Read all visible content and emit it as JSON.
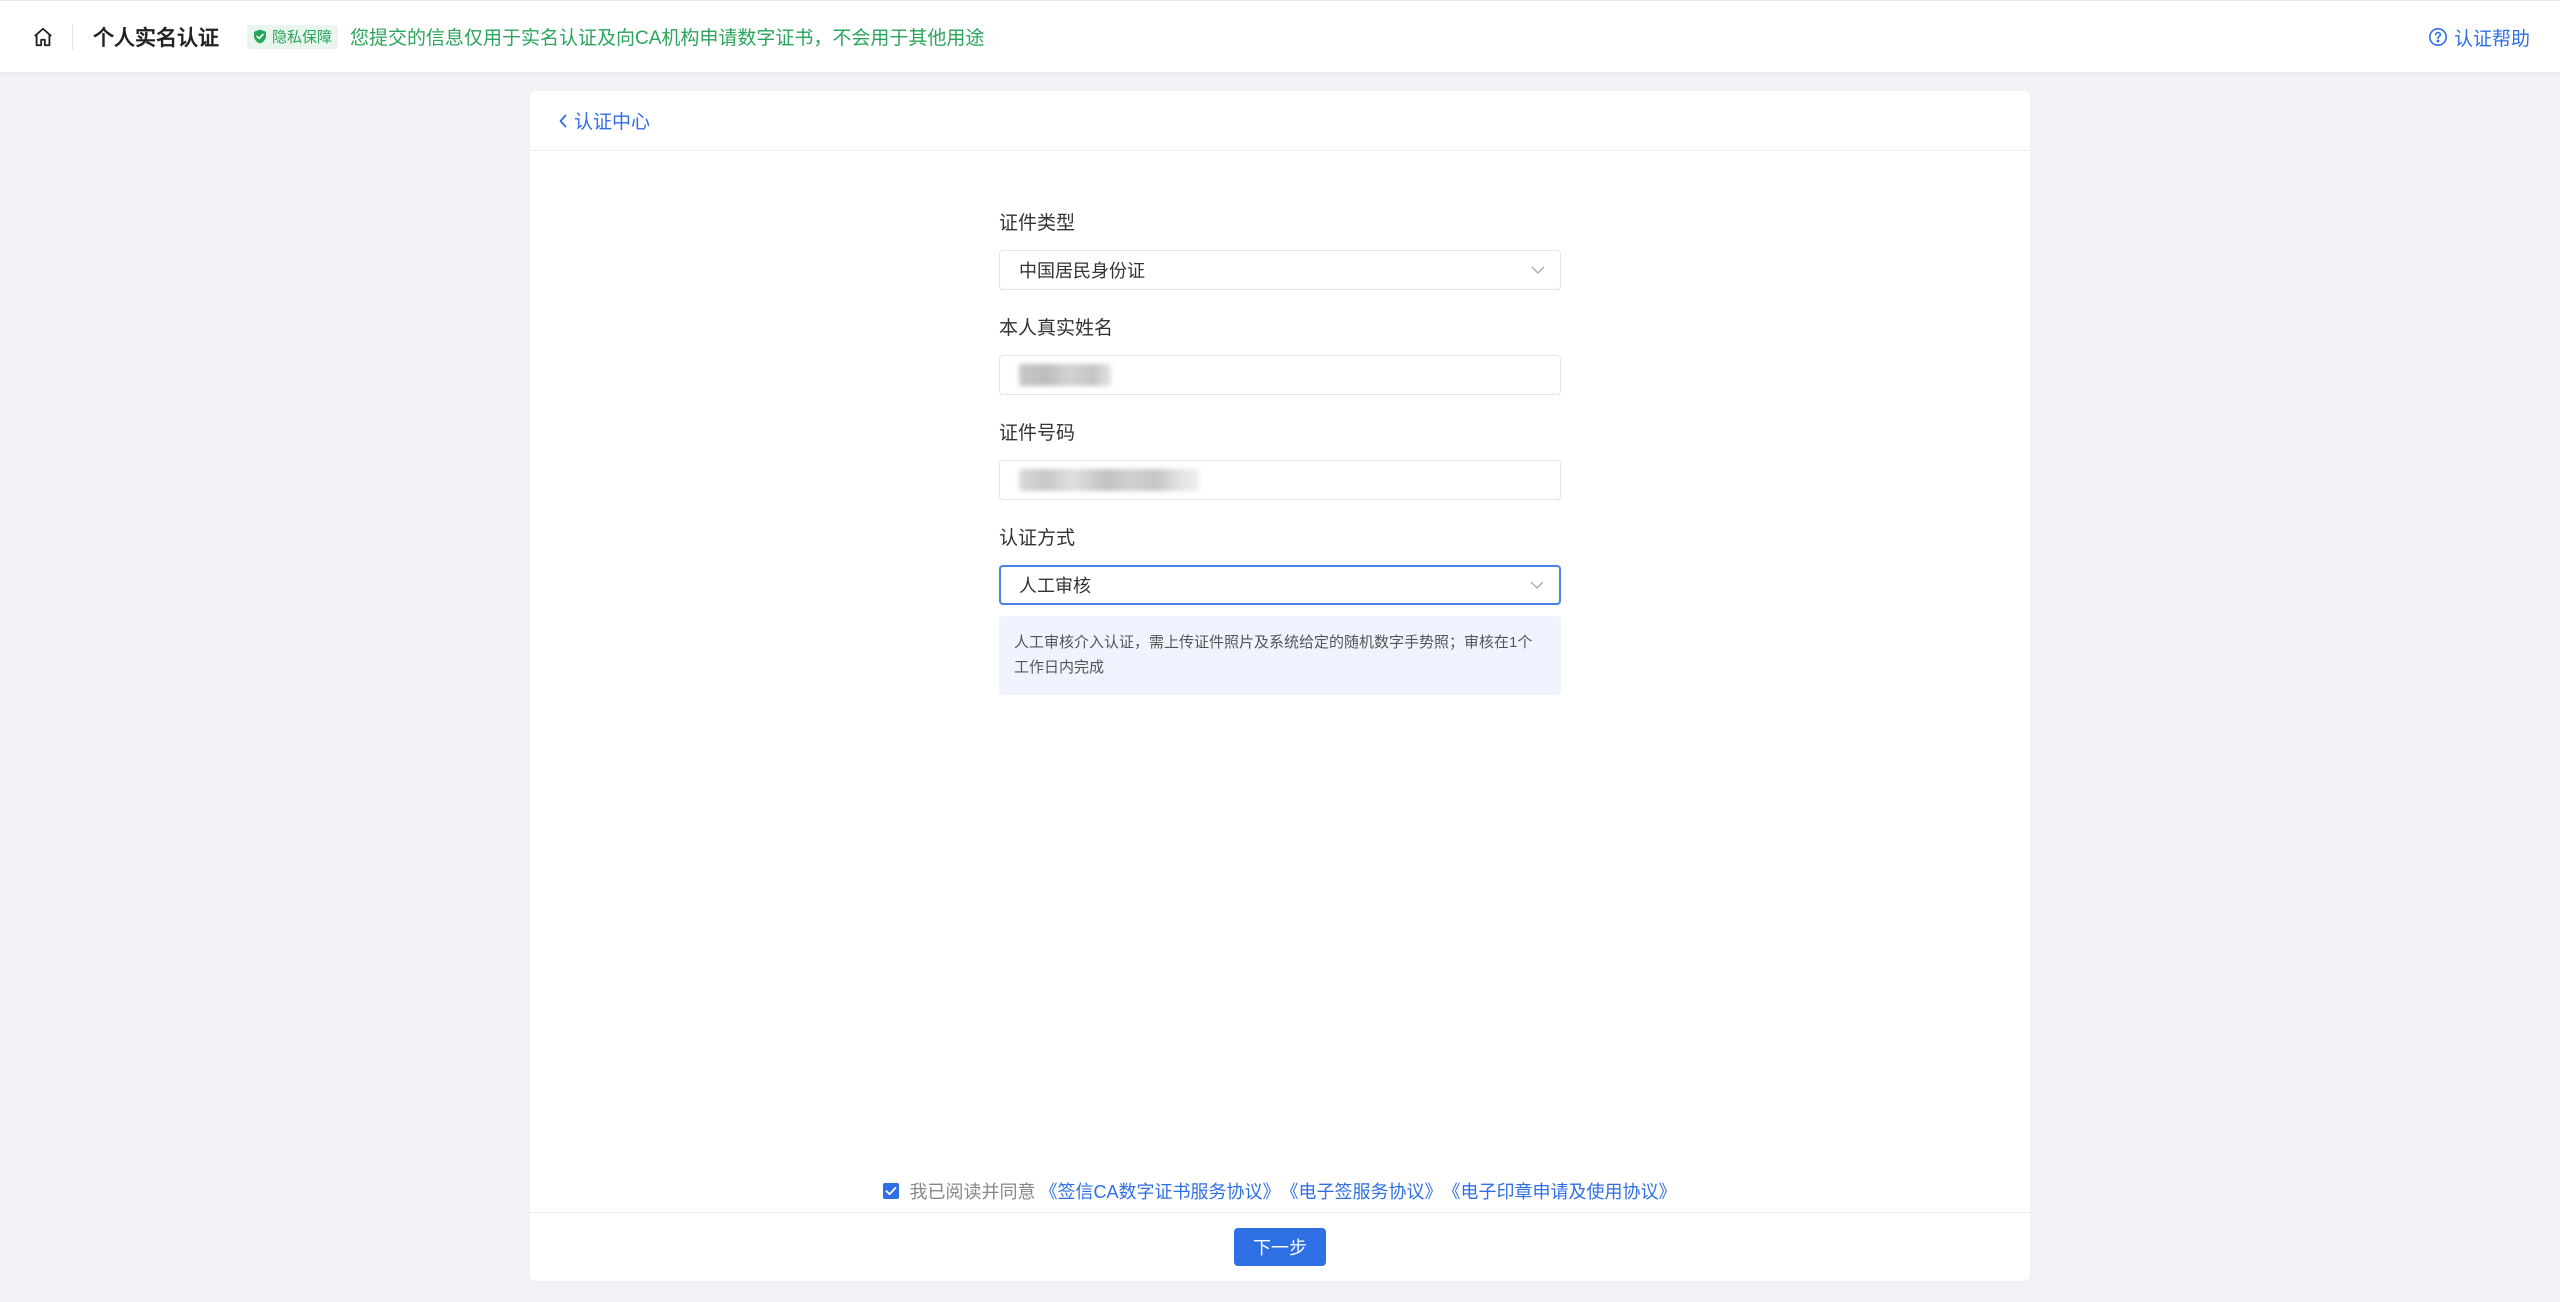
{
  "header": {
    "title": "个人实名认证",
    "privacy_badge": "隐私保障",
    "privacy_notice": "您提交的信息仅用于实名认证及向CA机构申请数字证书，不会用于其他用途",
    "help": "认证帮助"
  },
  "card": {
    "back_link": "认证中心"
  },
  "form": {
    "id_type": {
      "label": "证件类型",
      "value": "中国居民身份证"
    },
    "real_name": {
      "label": "本人真实姓名"
    },
    "id_number": {
      "label": "证件号码"
    },
    "auth_method": {
      "label": "认证方式",
      "value": "人工审核",
      "note": "人工审核介入认证，需上传证件照片及系统给定的随机数字手势照；审核在1个工作日内完成"
    }
  },
  "agreement": {
    "checked": true,
    "prefix": "我已阅读并同意",
    "links": [
      "《签信CA数字证书服务协议》",
      "《电子签服务协议》",
      "《电子印章申请及使用协议》"
    ]
  },
  "footer": {
    "next_button": "下一步"
  },
  "colors": {
    "primary": "#2f6fe4",
    "privacy_green": "#2ba55c",
    "background": "#f1f2f5",
    "note_bg": "#eef3fd"
  },
  "icons": [
    "home-icon",
    "shield-check-icon",
    "question-circle-icon",
    "chevron-left-icon",
    "chevron-down-icon",
    "checkmark-icon"
  ]
}
